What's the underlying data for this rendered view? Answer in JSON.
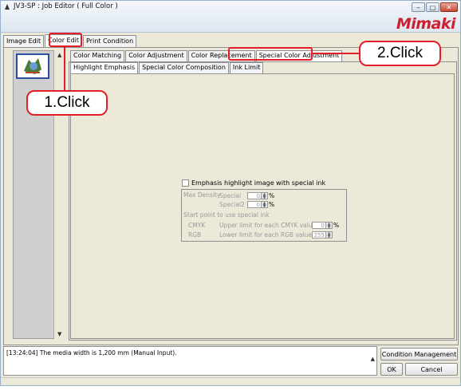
{
  "window": {
    "title": "JV3-SP : Job Editor ( Full Color )",
    "brand": "Mimaki",
    "controls": {
      "minimize": "‒",
      "maximize": "□",
      "close": "✕"
    }
  },
  "top_tabs": [
    {
      "label": "Image Edit",
      "active": false
    },
    {
      "label": "Color Edit",
      "active": true
    },
    {
      "label": "Print Condition",
      "active": false
    }
  ],
  "color_tabs": [
    {
      "label": "Color Matching",
      "active": false
    },
    {
      "label": "Color Adjustment",
      "active": false
    },
    {
      "label": "Color Replacement",
      "active": false
    },
    {
      "label": "Special Color Adjustment",
      "active": true
    }
  ],
  "special_tabs": [
    {
      "label": "Highlight Emphasis",
      "active": true
    },
    {
      "label": "Special Color Composition",
      "active": false
    },
    {
      "label": "Ink Limit",
      "active": false
    }
  ],
  "highlight": {
    "checkbox_label": "Emphasis highlight image with special ink",
    "checked": false,
    "max_density_label": "Max Density",
    "special_label": "Special",
    "special_value": "0",
    "special2_label": "Special2",
    "special2_value": "0",
    "percent": "%",
    "start_point_label": "Start point to use special ink",
    "cmyk_label": "CMYK",
    "cmyk_desc": "Upper limit for each CMYK value",
    "cmyk_value": "0",
    "rgb_label": "RGB",
    "rgb_desc": "Lower limit for each RGB value",
    "rgb_value": "255"
  },
  "log": {
    "message": "[13:24:04] The media width is 1,200 mm (Manual Input)."
  },
  "buttons": {
    "condition_management": "Condition Management",
    "ok": "OK",
    "cancel": "Cancel"
  },
  "annotations": {
    "step1": "1.Click",
    "step2": "2.Click"
  },
  "colors": {
    "accent_red": "#e21f26",
    "brand_red": "#cf1f2e"
  }
}
